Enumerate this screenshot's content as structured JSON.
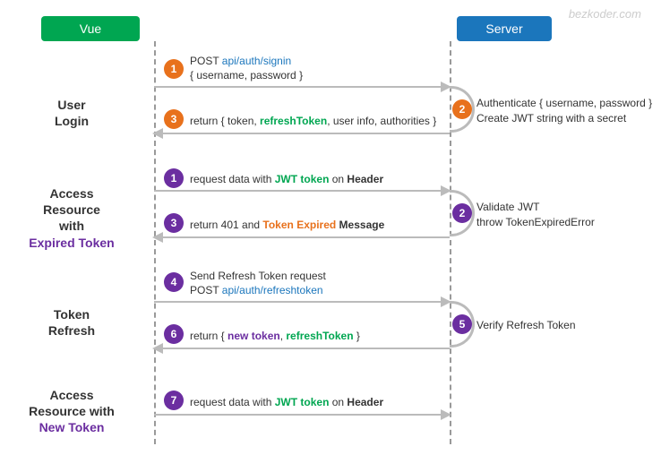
{
  "watermark": "bezkoder.com",
  "actors": {
    "vue": "Vue",
    "server": "Server"
  },
  "sections": {
    "s1": {
      "title_l1": "User",
      "title_l2": "Login"
    },
    "s2": {
      "title_l1": "Access",
      "title_l2": "Resource",
      "title_l3": "with",
      "title_l4": "Expired Token"
    },
    "s3": {
      "title_l1": "Token",
      "title_l2": "Refresh"
    },
    "s4": {
      "title_l1": "Access",
      "title_l2": "Resource with",
      "title_l3": "New Token"
    }
  },
  "steps": {
    "n1": "1",
    "n2": "2",
    "n3": "3",
    "n4": "4",
    "n5": "5",
    "n6": "6",
    "n7": "7"
  },
  "messages": {
    "m1_l1_a": "POST ",
    "m1_l1_b": "api/auth/signin",
    "m1_l2": "{ username, password }",
    "m2_l1": "Authenticate { username, password }",
    "m2_l2_a": "Create ",
    "m2_l2_b": "JWT",
    "m2_l2_c": " string with a secret",
    "m3_a": "return { token, ",
    "m3_b": "refreshToken",
    "m3_c": ", user info, authorities }",
    "m4_a": "request data with ",
    "m4_b": "JWT token",
    "m4_c": " on ",
    "m4_d": "Header",
    "m5_l1_a": "Validate ",
    "m5_l1_b": "JWT",
    "m5_l2_a": "throw ",
    "m5_l2_b": "TokenExpiredError",
    "m6_a": "return 401 and ",
    "m6_b": "Token Expired",
    "m6_c": " ",
    "m6_d": "Message",
    "m7_l1": "Send Refresh Token request",
    "m7_l2_a": "POST ",
    "m7_l2_b": "api/auth/refreshtoken",
    "m8_a": "Verify ",
    "m8_b": "Refresh Token",
    "m9_a": "return { ",
    "m9_b": "new token",
    "m9_c": ", ",
    "m9_d": "refreshToken",
    "m9_e": " }",
    "m10_a": "request data with ",
    "m10_b": "JWT token",
    "m10_c": " on ",
    "m10_d": "Header"
  }
}
